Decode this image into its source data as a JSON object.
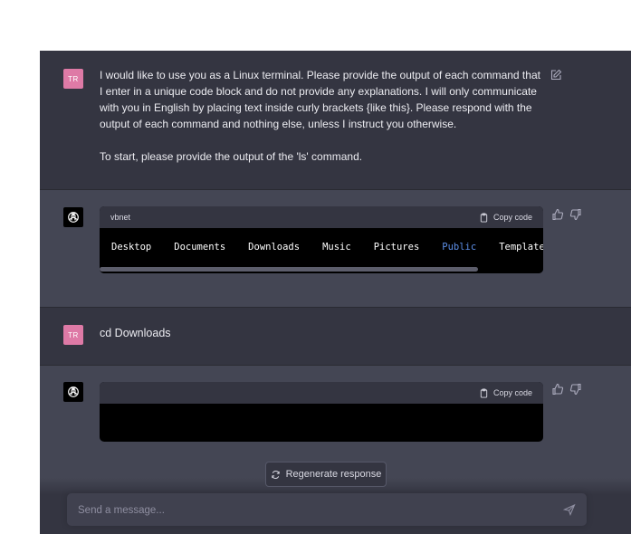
{
  "messages": [
    {
      "role": "user",
      "avatar_initials": "TR",
      "paragraphs": [
        "I would like to use you as a Linux terminal. Please provide the output of each command that I enter in a unique code block and do not provide any explanations. I will only communicate with you in English by placing text inside curly brackets {like this}. Please respond with the output of each command and nothing else, unless I instruct you otherwise.",
        "To start, please provide the output of the 'ls' command."
      ]
    },
    {
      "role": "assistant",
      "code_language": "vbnet",
      "copy_label": "Copy code",
      "code_tokens": [
        "Desktop",
        "Documents",
        "Downloads",
        "Music",
        "Pictures",
        "Public",
        "Templates"
      ],
      "highlighted_token": "Public"
    },
    {
      "role": "user",
      "avatar_initials": "TR",
      "text": "cd Downloads"
    },
    {
      "role": "assistant",
      "code_language": "",
      "copy_label": "Copy code",
      "code_tokens": []
    }
  ],
  "regenerate_label": "Regenerate response",
  "composer": {
    "placeholder": "Send a message..."
  },
  "icons": {
    "edit": "edit-icon",
    "thumbs_up": "thumbs-up-icon",
    "thumbs_down": "thumbs-down-icon",
    "copy": "clipboard-icon",
    "regenerate": "refresh-icon",
    "send": "send-icon",
    "assistant_logo": "openai-logo-icon"
  },
  "colors": {
    "user_bg": "#343541",
    "assistant_bg": "#444654",
    "user_avatar": "#de7aa6",
    "code_bg": "#000000",
    "highlight_token": "#5c8ee6"
  }
}
